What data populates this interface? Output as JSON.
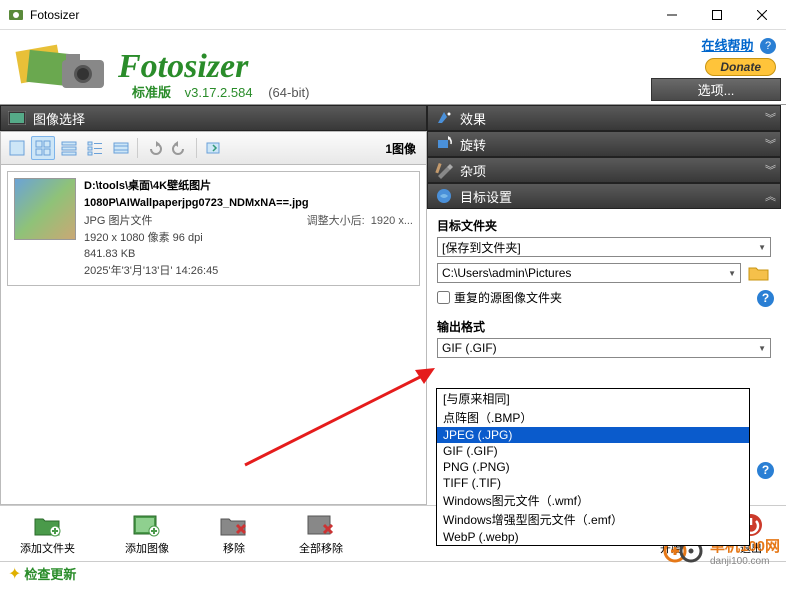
{
  "window": {
    "title": "Fotosizer"
  },
  "header": {
    "logo_text": "Fotosizer",
    "online_help": "在线帮助",
    "donate": "Donate",
    "edition": "标准版",
    "version": "v3.17.2.584",
    "bits": "(64-bit)",
    "options": "选项..."
  },
  "left": {
    "section_title": "图像选择",
    "count": "1图像",
    "item": {
      "path": "D:\\tools\\桌面\\4K壁纸图片 1080P\\AIWallpaperjpg0723_NDMxNA==.jpg",
      "type": "JPG 图片文件",
      "resize_label": "调整大小后:",
      "resize_val": "1920 x...",
      "dims": "1920 x 1080 像素 96 dpi",
      "size": "841.83 KB",
      "date": "2025'年'3'月'13'日' 14:26:45"
    }
  },
  "right": {
    "effects": "效果",
    "rotate": "旋转",
    "misc": "杂项",
    "dest": "目标设置",
    "dest_folder_label": "目标文件夹",
    "dest_folder_sel": "[保存到文件夹]",
    "dest_path": "C:\\Users\\admin\\Pictures",
    "repeat_src": "重复的源图像文件夹",
    "output_fmt_label": "输出格式",
    "output_fmt_sel": "GIF (.GIF)",
    "fmt_options": [
      "[与原来相同]",
      "点阵图（.BMP）",
      "JPEG (.JPG)",
      "GIF (.GIF)",
      "PNG (.PNG)",
      "TIFF (.TIF)",
      "Windows图元文件（.wmf）",
      "Windows增强型图元文件（.emf）",
      "WebP (.webp)"
    ],
    "fmt_selected_index": 2
  },
  "bottom": {
    "add_folder": "添加文件夹",
    "add_image": "添加图像",
    "remove": "移除",
    "remove_all": "全部移除",
    "start": "开始",
    "exit": "退出"
  },
  "status": {
    "check_update": "检查更新"
  },
  "watermark": {
    "brand": "单机100网",
    "url": "danji100.com"
  }
}
